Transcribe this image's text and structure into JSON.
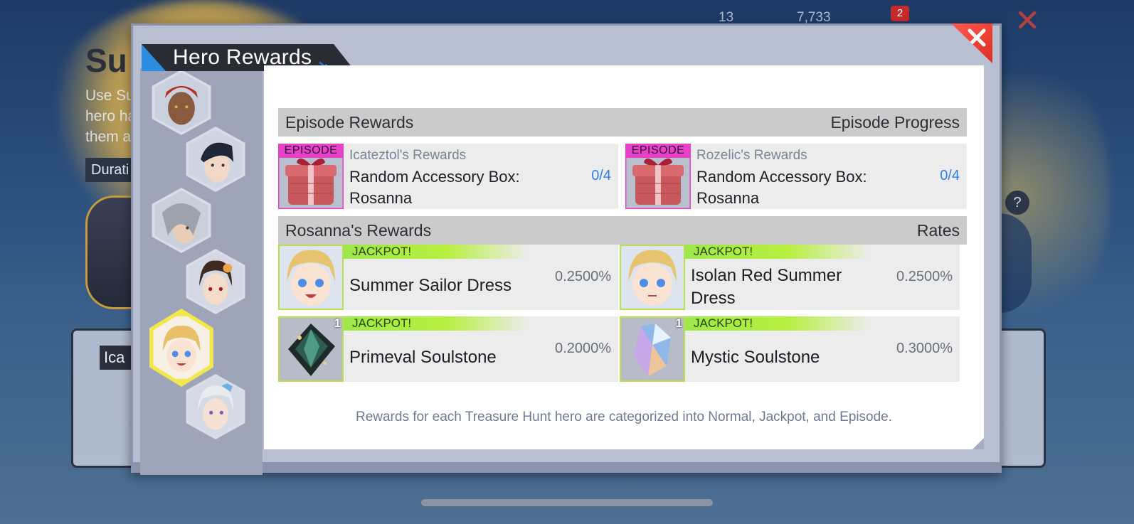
{
  "background": {
    "event_title": "Su",
    "event_desc": "Use Su hero ha them a",
    "duration_label": "Durati",
    "tab_label": "Ica",
    "stat_1": "13",
    "stat_2": "7,733",
    "mail_badge": "2",
    "help_glyph": "?"
  },
  "modal": {
    "title": "Hero Rewards",
    "close_icon": "close-icon",
    "accent_color": "#2b8de0",
    "close_color": "#e02c22"
  },
  "heroes": [
    {
      "id": "hero-red-hair",
      "selected": false
    },
    {
      "id": "hero-dark-hair",
      "selected": false
    },
    {
      "id": "hero-silver-hair",
      "selected": false
    },
    {
      "id": "hero-brown-hair",
      "selected": false
    },
    {
      "id": "hero-rosanna",
      "selected": true
    },
    {
      "id": "hero-white-hair",
      "selected": false
    }
  ],
  "episode_section": {
    "header_left": "Episode Rewards",
    "header_right": "Episode Progress",
    "items": [
      {
        "tag": "EPISODE",
        "source": "Icateztol's Rewards",
        "name": "Random Accessory Box: Rosanna",
        "progress": "0/4",
        "icon": "gift-box-icon"
      },
      {
        "tag": "EPISODE",
        "source": "Rozelic's Rewards",
        "name": "Random Accessory Box: Rosanna",
        "progress": "0/4",
        "icon": "gift-box-icon"
      }
    ]
  },
  "rewards_section": {
    "header_left": "Rosanna's Rewards",
    "header_right": "Rates",
    "items": [
      {
        "tag": "JACKPOT!",
        "name": "Summer Sailor Dress",
        "rate": "0.2500%",
        "icon": "rosanna-portrait-icon",
        "qty": ""
      },
      {
        "tag": "JACKPOT!",
        "name": "Isolan Red Summer Dress",
        "rate": "0.2500%",
        "icon": "rosanna-portrait-icon",
        "qty": ""
      },
      {
        "tag": "JACKPOT!",
        "name": "Primeval Soulstone",
        "rate": "0.2000%",
        "icon": "primeval-soulstone-icon",
        "qty": "1"
      },
      {
        "tag": "JACKPOT!",
        "name": "Mystic Soulstone",
        "rate": "0.3000%",
        "icon": "mystic-soulstone-icon",
        "qty": "1"
      }
    ]
  },
  "footnote": "Rewards for each Treasure Hunt hero are categorized into Normal, Jackpot, and Episode.",
  "colors": {
    "episode_tag": "#e840c9",
    "jackpot_bar": "#9fe84a",
    "progress_text": "#2f7ef0",
    "selected_hero_border": "#f2e84a"
  }
}
